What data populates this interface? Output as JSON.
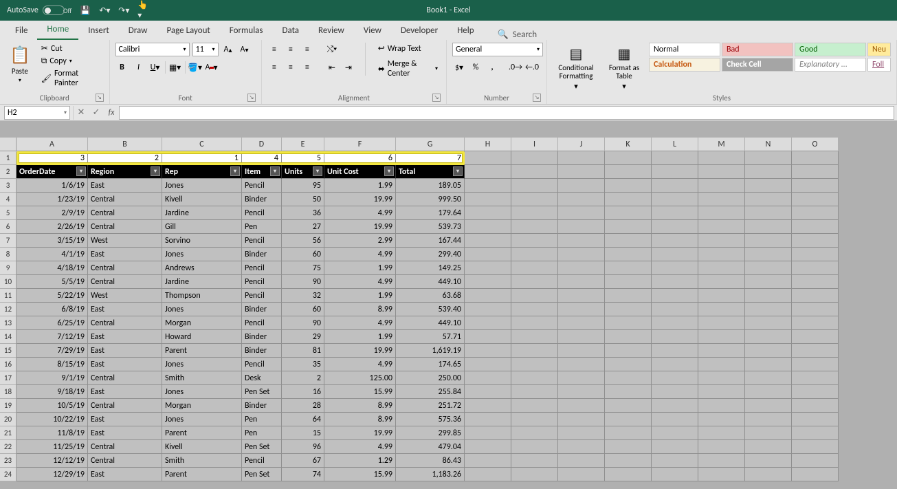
{
  "titlebar": {
    "autosave_label": "AutoSave",
    "autosave_state": "Off",
    "doc_title": "Book1  -  Excel"
  },
  "tabs": {
    "file": "File",
    "home": "Home",
    "insert": "Insert",
    "draw": "Draw",
    "page_layout": "Page Layout",
    "formulas": "Formulas",
    "data": "Data",
    "review": "Review",
    "view": "View",
    "developer": "Developer",
    "help": "Help",
    "search": "Search"
  },
  "ribbon": {
    "clipboard": {
      "paste": "Paste",
      "cut": "Cut",
      "copy": "Copy",
      "format_painter": "Format Painter",
      "group": "Clipboard"
    },
    "font": {
      "name": "Calibri",
      "size": "11",
      "group": "Font"
    },
    "alignment": {
      "wrap": "Wrap Text",
      "merge": "Merge & Center",
      "group": "Alignment"
    },
    "number": {
      "format": "General",
      "group": "Number"
    },
    "styles": {
      "cond_fmt": "Conditional Formatting",
      "format_table": "Format as Table",
      "normal": "Normal",
      "bad": "Bad",
      "good": "Good",
      "neutral": "Neu",
      "calculation": "Calculation",
      "check_cell": "Check Cell",
      "explanatory": "Explanatory ...",
      "follow": "Foll",
      "group": "Styles"
    }
  },
  "name_box": "H2",
  "columns": [
    "A",
    "B",
    "C",
    "D",
    "E",
    "F",
    "G",
    "H",
    "I",
    "J",
    "K",
    "L",
    "M",
    "N",
    "O"
  ],
  "row1": [
    "3",
    "2",
    "1",
    "4",
    "5",
    "6",
    "7"
  ],
  "headers": [
    "OrderDate",
    "Region",
    "Rep",
    "Item",
    "Units",
    "Unit Cost",
    "Total"
  ],
  "data_rows": [
    {
      "n": 3,
      "d": "1/6/19",
      "r": "East",
      "p": "Jones",
      "i": "Pencil",
      "u": "95",
      "c": "1.99",
      "t": "189.05"
    },
    {
      "n": 4,
      "d": "1/23/19",
      "r": "Central",
      "p": "Kivell",
      "i": "Binder",
      "u": "50",
      "c": "19.99",
      "t": "999.50"
    },
    {
      "n": 5,
      "d": "2/9/19",
      "r": "Central",
      "p": "Jardine",
      "i": "Pencil",
      "u": "36",
      "c": "4.99",
      "t": "179.64"
    },
    {
      "n": 6,
      "d": "2/26/19",
      "r": "Central",
      "p": "Gill",
      "i": "Pen",
      "u": "27",
      "c": "19.99",
      "t": "539.73"
    },
    {
      "n": 7,
      "d": "3/15/19",
      "r": "West",
      "p": "Sorvino",
      "i": "Pencil",
      "u": "56",
      "c": "2.99",
      "t": "167.44"
    },
    {
      "n": 8,
      "d": "4/1/19",
      "r": "East",
      "p": "Jones",
      "i": "Binder",
      "u": "60",
      "c": "4.99",
      "t": "299.40"
    },
    {
      "n": 9,
      "d": "4/18/19",
      "r": "Central",
      "p": "Andrews",
      "i": "Pencil",
      "u": "75",
      "c": "1.99",
      "t": "149.25"
    },
    {
      "n": 10,
      "d": "5/5/19",
      "r": "Central",
      "p": "Jardine",
      "i": "Pencil",
      "u": "90",
      "c": "4.99",
      "t": "449.10"
    },
    {
      "n": 11,
      "d": "5/22/19",
      "r": "West",
      "p": "Thompson",
      "i": "Pencil",
      "u": "32",
      "c": "1.99",
      "t": "63.68"
    },
    {
      "n": 12,
      "d": "6/8/19",
      "r": "East",
      "p": "Jones",
      "i": "Binder",
      "u": "60",
      "c": "8.99",
      "t": "539.40"
    },
    {
      "n": 13,
      "d": "6/25/19",
      "r": "Central",
      "p": "Morgan",
      "i": "Pencil",
      "u": "90",
      "c": "4.99",
      "t": "449.10"
    },
    {
      "n": 14,
      "d": "7/12/19",
      "r": "East",
      "p": "Howard",
      "i": "Binder",
      "u": "29",
      "c": "1.99",
      "t": "57.71"
    },
    {
      "n": 15,
      "d": "7/29/19",
      "r": "East",
      "p": "Parent",
      "i": "Binder",
      "u": "81",
      "c": "19.99",
      "t": "1,619.19"
    },
    {
      "n": 16,
      "d": "8/15/19",
      "r": "East",
      "p": "Jones",
      "i": "Pencil",
      "u": "35",
      "c": "4.99",
      "t": "174.65"
    },
    {
      "n": 17,
      "d": "9/1/19",
      "r": "Central",
      "p": "Smith",
      "i": "Desk",
      "u": "2",
      "c": "125.00",
      "t": "250.00"
    },
    {
      "n": 18,
      "d": "9/18/19",
      "r": "East",
      "p": "Jones",
      "i": "Pen Set",
      "u": "16",
      "c": "15.99",
      "t": "255.84"
    },
    {
      "n": 19,
      "d": "10/5/19",
      "r": "Central",
      "p": "Morgan",
      "i": "Binder",
      "u": "28",
      "c": "8.99",
      "t": "251.72"
    },
    {
      "n": 20,
      "d": "10/22/19",
      "r": "East",
      "p": "Jones",
      "i": "Pen",
      "u": "64",
      "c": "8.99",
      "t": "575.36"
    },
    {
      "n": 21,
      "d": "11/8/19",
      "r": "East",
      "p": "Parent",
      "i": "Pen",
      "u": "15",
      "c": "19.99",
      "t": "299.85"
    },
    {
      "n": 22,
      "d": "11/25/19",
      "r": "Central",
      "p": "Kivell",
      "i": "Pen Set",
      "u": "96",
      "c": "4.99",
      "t": "479.04"
    },
    {
      "n": 23,
      "d": "12/12/19",
      "r": "Central",
      "p": "Smith",
      "i": "Pencil",
      "u": "67",
      "c": "1.29",
      "t": "86.43"
    },
    {
      "n": 24,
      "d": "12/29/19",
      "r": "East",
      "p": "Parent",
      "i": "Pen Set",
      "u": "74",
      "c": "15.99",
      "t": "1,183.26"
    }
  ]
}
